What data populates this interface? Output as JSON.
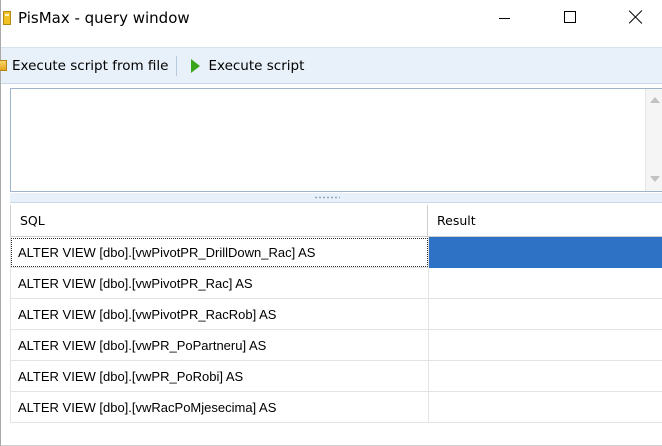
{
  "window": {
    "title": "PisMax - query window",
    "controls": [
      "minimize",
      "maximize",
      "close"
    ]
  },
  "toolbar": {
    "execute_file_label": "Execute script from file",
    "execute_label": "Execute script"
  },
  "editor": {
    "text": ""
  },
  "grid": {
    "columns": [
      "SQL",
      "Result"
    ],
    "rows": [
      {
        "sql": "ALTER VIEW [dbo].[vwPivotPR_DrillDown_Rac] AS",
        "result": "",
        "selected": true
      },
      {
        "sql": "ALTER VIEW [dbo].[vwPivotPR_Rac] AS",
        "result": ""
      },
      {
        "sql": "ALTER VIEW [dbo].[vwPivotPR_RacRob] AS",
        "result": ""
      },
      {
        "sql": "ALTER VIEW [dbo].[vwPR_PoPartneru] AS",
        "result": ""
      },
      {
        "sql": "ALTER VIEW [dbo].[vwPR_PoRobi] AS",
        "result": ""
      },
      {
        "sql": "ALTER VIEW [dbo].[vwRacPoMjesecima] AS",
        "result": ""
      }
    ]
  },
  "colors": {
    "toolbar_bg": "#e8f0f9",
    "selection": "#2e72c6",
    "play_icon": "#3aa51a"
  }
}
